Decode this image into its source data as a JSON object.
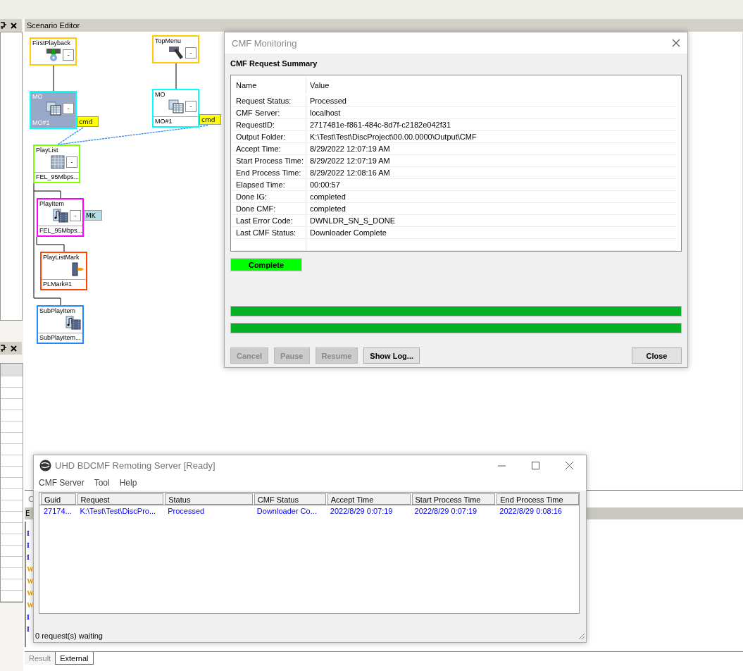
{
  "left_panels": {
    "log_tab": "C",
    "log_header": "E"
  },
  "scenario_editor": {
    "title": "Scenario Editor",
    "nodes": [
      {
        "title": "FirstPlayback",
        "kind": "disc",
        "collapse": "-",
        "selected": false,
        "color": "#ffcc00"
      },
      {
        "title": "TopMenu",
        "kind": "remote",
        "collapse": "-",
        "selected": false,
        "color": "#ffcc00"
      },
      {
        "title": "MO",
        "kind": "table",
        "collapse": "-",
        "footer": "MO#1",
        "selected": true,
        "color": "#00ffff",
        "tag": {
          "label": "cmd",
          "color": "#ffff00"
        }
      },
      {
        "title": "MO",
        "kind": "table",
        "collapse": "-",
        "footer": "MO#1",
        "selected": false,
        "color": "#00ffff",
        "tag": {
          "label": "cmd",
          "color": "#ffff00"
        }
      },
      {
        "title": "PlayList",
        "kind": "grid",
        "collapse": "-",
        "footer": "FEL_95Mbps...",
        "selected": false,
        "color": "#80ff00"
      },
      {
        "title": "PlayItem",
        "kind": "film",
        "collapse": "-",
        "footer": "FEL_95Mbps...",
        "selected": false,
        "color": "#ff00ff",
        "tag": {
          "label": "MK",
          "color": "#b0e0e6"
        }
      },
      {
        "title": "PlayListMark",
        "kind": "mark",
        "footer": "PLMark#1",
        "selected": false,
        "color": "#ff4400"
      },
      {
        "title": "SubPlayItem",
        "kind": "film",
        "footer": "SubPlayItem...",
        "selected": false,
        "color": "#2288ff"
      }
    ]
  },
  "log_lines": [
    {
      "kind": "info",
      "text": "I"
    },
    {
      "kind": "info",
      "text": "I"
    },
    {
      "kind": "info",
      "text": "I"
    },
    {
      "kind": "warning",
      "text": "W"
    },
    {
      "kind": "warning",
      "text": "W"
    },
    {
      "kind": "warning",
      "text": "W"
    },
    {
      "kind": "warning",
      "text": "W"
    },
    {
      "kind": "info",
      "text": "I"
    },
    {
      "kind": "info",
      "text": "I"
    }
  ],
  "bottom_tabs": [
    {
      "label": "Result",
      "selected": false
    },
    {
      "label": "External",
      "selected": true
    }
  ],
  "cmf_dialog": {
    "title": "CMF Monitoring",
    "heading": "CMF Request Summary",
    "columns": [
      "Name",
      "Value"
    ],
    "rows": [
      [
        "Request Status:",
        "Processed"
      ],
      [
        "CMF Server:",
        "localhost"
      ],
      [
        "RequestID:",
        "2717481e-f861-484c-8d7f-c2182e042f31"
      ],
      [
        "Output Folder:",
        "K:\\Test\\Test\\DiscProject\\00.00.0000\\Output\\CMF"
      ],
      [
        "Accept Time:",
        "8/29/2022 12:07:19 AM"
      ],
      [
        "Start Process Time:",
        "8/29/2022 12:07:19 AM"
      ],
      [
        "End Process Time:",
        "8/29/2022 12:08:16 AM"
      ],
      [
        "Elapsed Time:",
        "00:00:57"
      ],
      [
        "Done IG:",
        "completed"
      ],
      [
        "Done CMF:",
        "completed"
      ],
      [
        "Last Error Code:",
        "DWNLDR_SN_S_DONE"
      ],
      [
        "Last CMF Status:",
        "Downloader Complete"
      ]
    ],
    "status_badge": "Complete",
    "progress": [
      {
        "level": 1
      },
      {
        "level": 1
      }
    ],
    "buttons": [
      {
        "label": "Cancel",
        "disabled": true
      },
      {
        "label": "Pause",
        "disabled": true
      },
      {
        "label": "Resume",
        "disabled": true
      },
      {
        "label": "Show Log...",
        "disabled": false
      },
      {
        "label": "Close",
        "disabled": false
      }
    ]
  },
  "server_window": {
    "title": "UHD BDCMF Remoting Server [Ready]",
    "menu": [
      "CMF Server",
      "Tool",
      "Help"
    ],
    "columns": [
      "Guid",
      "Request",
      "Status",
      "CMF Status",
      "Accept Time",
      "Start Process Time",
      "End Process Time"
    ],
    "rows": [
      [
        "27174...",
        "K:\\Test\\Test\\DiscPro...",
        "Processed",
        "Downloader Co...",
        "2022/8/29 0:07:19",
        "2022/8/29 0:07:19",
        "2022/8/29 0:08:16"
      ]
    ],
    "status": "0 request(s) waiting"
  }
}
